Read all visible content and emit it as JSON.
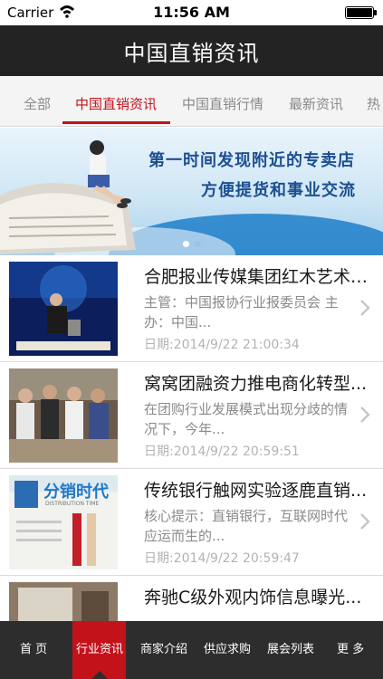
{
  "status_bar": {
    "carrier": "Carrier",
    "time": "11:56 AM",
    "battery_level": 1.0
  },
  "nav": {
    "title": "中国直销资讯"
  },
  "tabs": [
    {
      "label": "全部"
    },
    {
      "label": "中国直销资讯",
      "active": true
    },
    {
      "label": "中国直销行情"
    },
    {
      "label": "最新资讯"
    },
    {
      "label": "热"
    }
  ],
  "banner": {
    "line1": "第一时间发现附近的专卖店",
    "line2": "方便提货和事业交流",
    "slide_count": 2,
    "active_slide": 1
  },
  "news": [
    {
      "title": "合肥报业传媒集团红木艺术品...",
      "summary": "主管：中国报协行业报委员会 主办：中国...",
      "date": "日期:2014/9/22 21:00:34"
    },
    {
      "title": "窝窝团融资力推电商化转型...",
      "summary": "在团购行业发展模式出现分歧的情况下，今年...",
      "date": "日期:2014/9/22 20:59:51"
    },
    {
      "title": "传统银行触网实验逐鹿直销...",
      "summary": "核心提示：直销银行，互联网时代应运而生的...",
      "date": "日期:2014/9/22 20:59:47",
      "thumb_text": "分销时代",
      "thumb_sub": "DISTRIBUTION TIME"
    },
    {
      "title": "奔驰C级外观内饰信息曝光...",
      "summary": "",
      "date": ""
    }
  ],
  "bottom_tabs": [
    {
      "label": "首 页"
    },
    {
      "label": "行业资讯",
      "active": true
    },
    {
      "label": "商家介绍"
    },
    {
      "label": "供应求购"
    },
    {
      "label": "展会列表"
    },
    {
      "label": "更 多"
    }
  ],
  "colors": {
    "accent": "#c4121a",
    "nav_bg": "#232323",
    "bottom_bg": "#2d2d2d"
  }
}
